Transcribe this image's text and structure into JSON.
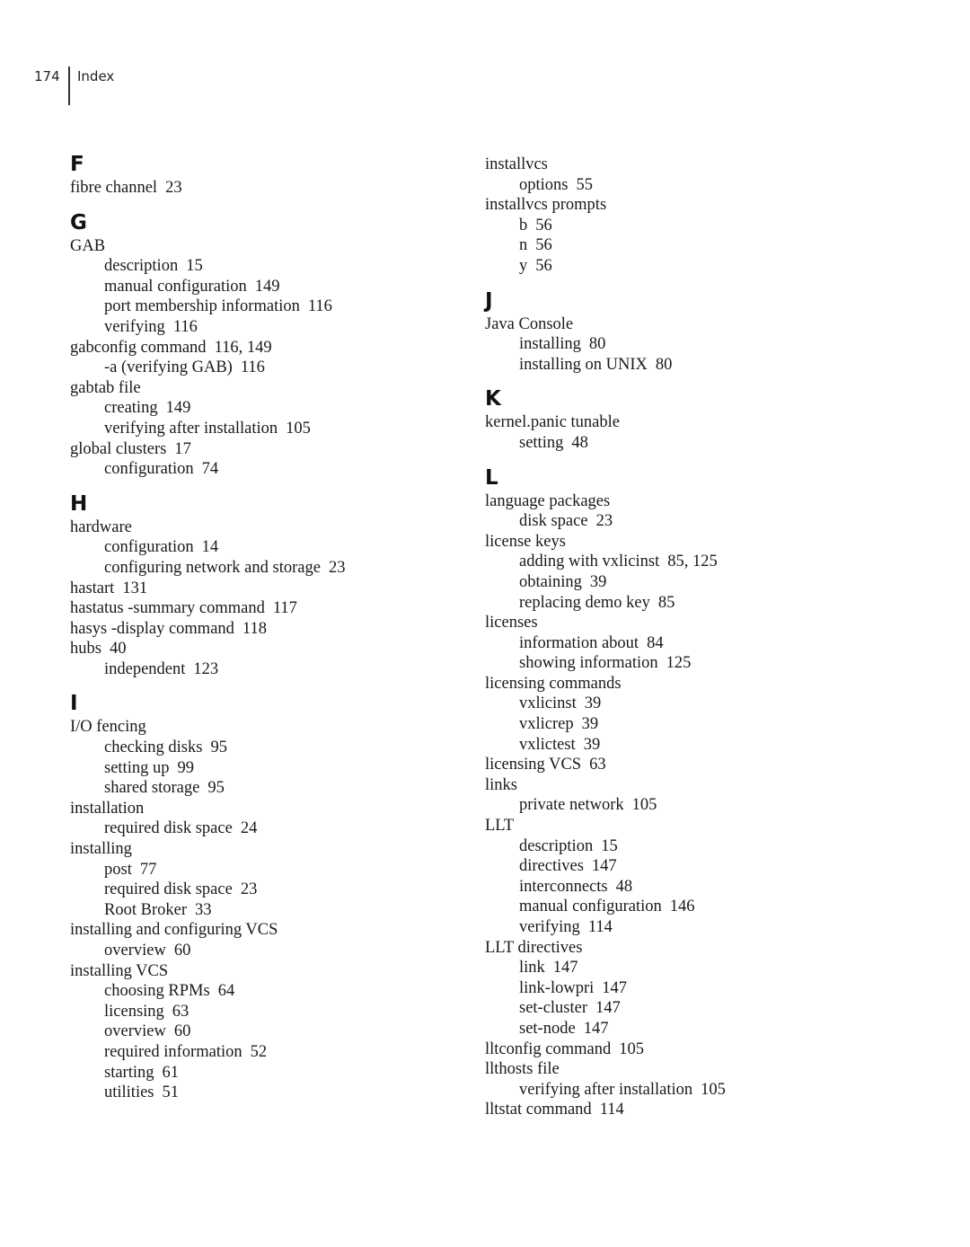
{
  "header": {
    "page_number": "174",
    "section_title": "Index"
  },
  "columns": [
    {
      "letters": [
        {
          "letter": "F",
          "entries": [
            {
              "term": "fibre channel",
              "pages": "23",
              "level": 0
            }
          ]
        },
        {
          "letter": "G",
          "entries": [
            {
              "term": "GAB",
              "pages": "",
              "level": 0
            },
            {
              "term": "description",
              "pages": "15",
              "level": 1
            },
            {
              "term": "manual configuration",
              "pages": "149",
              "level": 1
            },
            {
              "term": "port membership information",
              "pages": "116",
              "level": 1
            },
            {
              "term": "verifying",
              "pages": "116",
              "level": 1
            },
            {
              "term": "gabconfig command",
              "pages": "116, 149",
              "level": 0
            },
            {
              "term": "-a (verifying GAB)",
              "pages": "116",
              "level": 1
            },
            {
              "term": "gabtab file",
              "pages": "",
              "level": 0
            },
            {
              "term": "creating",
              "pages": "149",
              "level": 1
            },
            {
              "term": "verifying after installation",
              "pages": "105",
              "level": 1
            },
            {
              "term": "global clusters",
              "pages": "17",
              "level": 0
            },
            {
              "term": "configuration",
              "pages": "74",
              "level": 1
            }
          ]
        },
        {
          "letter": "H",
          "entries": [
            {
              "term": "hardware",
              "pages": "",
              "level": 0
            },
            {
              "term": "configuration",
              "pages": "14",
              "level": 1
            },
            {
              "term": "configuring network and storage",
              "pages": "23",
              "level": 1
            },
            {
              "term": "hastart",
              "pages": "131",
              "level": 0
            },
            {
              "term": "hastatus -summary command",
              "pages": "117",
              "level": 0
            },
            {
              "term": "hasys -display command",
              "pages": "118",
              "level": 0
            },
            {
              "term": "hubs",
              "pages": "40",
              "level": 0
            },
            {
              "term": "independent",
              "pages": "123",
              "level": 1
            }
          ]
        },
        {
          "letter": "I",
          "entries": [
            {
              "term": "I/O fencing",
              "pages": "",
              "level": 0
            },
            {
              "term": "checking disks",
              "pages": "95",
              "level": 1
            },
            {
              "term": "setting up",
              "pages": "99",
              "level": 1
            },
            {
              "term": "shared storage",
              "pages": "95",
              "level": 1
            },
            {
              "term": "installation",
              "pages": "",
              "level": 0
            },
            {
              "term": "required disk space",
              "pages": "24",
              "level": 1
            },
            {
              "term": "installing",
              "pages": "",
              "level": 0
            },
            {
              "term": "post",
              "pages": "77",
              "level": 1
            },
            {
              "term": "required disk space",
              "pages": "23",
              "level": 1
            },
            {
              "term": "Root Broker",
              "pages": "33",
              "level": 1
            },
            {
              "term": "installing and configuring VCS",
              "pages": "",
              "level": 0
            },
            {
              "term": "overview",
              "pages": "60",
              "level": 1
            },
            {
              "term": "installing VCS",
              "pages": "",
              "level": 0
            },
            {
              "term": "choosing RPMs",
              "pages": "64",
              "level": 1
            },
            {
              "term": "licensing",
              "pages": "63",
              "level": 1
            },
            {
              "term": "overview",
              "pages": "60",
              "level": 1
            },
            {
              "term": "required information",
              "pages": "52",
              "level": 1
            },
            {
              "term": "starting",
              "pages": "61",
              "level": 1
            },
            {
              "term": "utilities",
              "pages": "51",
              "level": 1
            }
          ]
        }
      ]
    },
    {
      "letters": [
        {
          "letter": "",
          "entries": [
            {
              "term": "installvcs",
              "pages": "",
              "level": 0
            },
            {
              "term": "options",
              "pages": "55",
              "level": 1
            },
            {
              "term": "installvcs prompts",
              "pages": "",
              "level": 0
            },
            {
              "term": "b",
              "pages": "56",
              "level": 1
            },
            {
              "term": "n",
              "pages": "56",
              "level": 1
            },
            {
              "term": "y",
              "pages": "56",
              "level": 1
            }
          ]
        },
        {
          "letter": "J",
          "entries": [
            {
              "term": "Java Console",
              "pages": "",
              "level": 0
            },
            {
              "term": "installing",
              "pages": "80",
              "level": 1
            },
            {
              "term": "installing on UNIX",
              "pages": "80",
              "level": 1
            }
          ]
        },
        {
          "letter": "K",
          "entries": [
            {
              "term": "kernel.panic tunable",
              "pages": "",
              "level": 0
            },
            {
              "term": "setting",
              "pages": "48",
              "level": 1
            }
          ]
        },
        {
          "letter": "L",
          "entries": [
            {
              "term": "language packages",
              "pages": "",
              "level": 0
            },
            {
              "term": "disk space",
              "pages": "23",
              "level": 1
            },
            {
              "term": "license keys",
              "pages": "",
              "level": 0
            },
            {
              "term": "adding with vxlicinst",
              "pages": "85, 125",
              "level": 1
            },
            {
              "term": "obtaining",
              "pages": "39",
              "level": 1
            },
            {
              "term": "replacing demo key",
              "pages": "85",
              "level": 1
            },
            {
              "term": "licenses",
              "pages": "",
              "level": 0
            },
            {
              "term": "information about",
              "pages": "84",
              "level": 1
            },
            {
              "term": "showing information",
              "pages": "125",
              "level": 1
            },
            {
              "term": "licensing commands",
              "pages": "",
              "level": 0
            },
            {
              "term": "vxlicinst",
              "pages": "39",
              "level": 1
            },
            {
              "term": "vxlicrep",
              "pages": "39",
              "level": 1
            },
            {
              "term": "vxlictest",
              "pages": "39",
              "level": 1
            },
            {
              "term": "licensing VCS",
              "pages": "63",
              "level": 0
            },
            {
              "term": "links",
              "pages": "",
              "level": 0
            },
            {
              "term": "private network",
              "pages": "105",
              "level": 1
            },
            {
              "term": "LLT",
              "pages": "",
              "level": 0
            },
            {
              "term": "description",
              "pages": "15",
              "level": 1
            },
            {
              "term": "directives",
              "pages": "147",
              "level": 1
            },
            {
              "term": "interconnects",
              "pages": "48",
              "level": 1
            },
            {
              "term": "manual configuration",
              "pages": "146",
              "level": 1
            },
            {
              "term": "verifying",
              "pages": "114",
              "level": 1
            },
            {
              "term": "LLT directives",
              "pages": "",
              "level": 0
            },
            {
              "term": "link",
              "pages": "147",
              "level": 1
            },
            {
              "term": "link-lowpri",
              "pages": "147",
              "level": 1
            },
            {
              "term": "set-cluster",
              "pages": "147",
              "level": 1
            },
            {
              "term": "set-node",
              "pages": "147",
              "level": 1
            },
            {
              "term": "lltconfig command",
              "pages": "105",
              "level": 0
            },
            {
              "term": "llthosts file",
              "pages": "",
              "level": 0
            },
            {
              "term": "verifying after installation",
              "pages": "105",
              "level": 1
            },
            {
              "term": "lltstat command",
              "pages": "114",
              "level": 0
            }
          ]
        }
      ]
    }
  ]
}
